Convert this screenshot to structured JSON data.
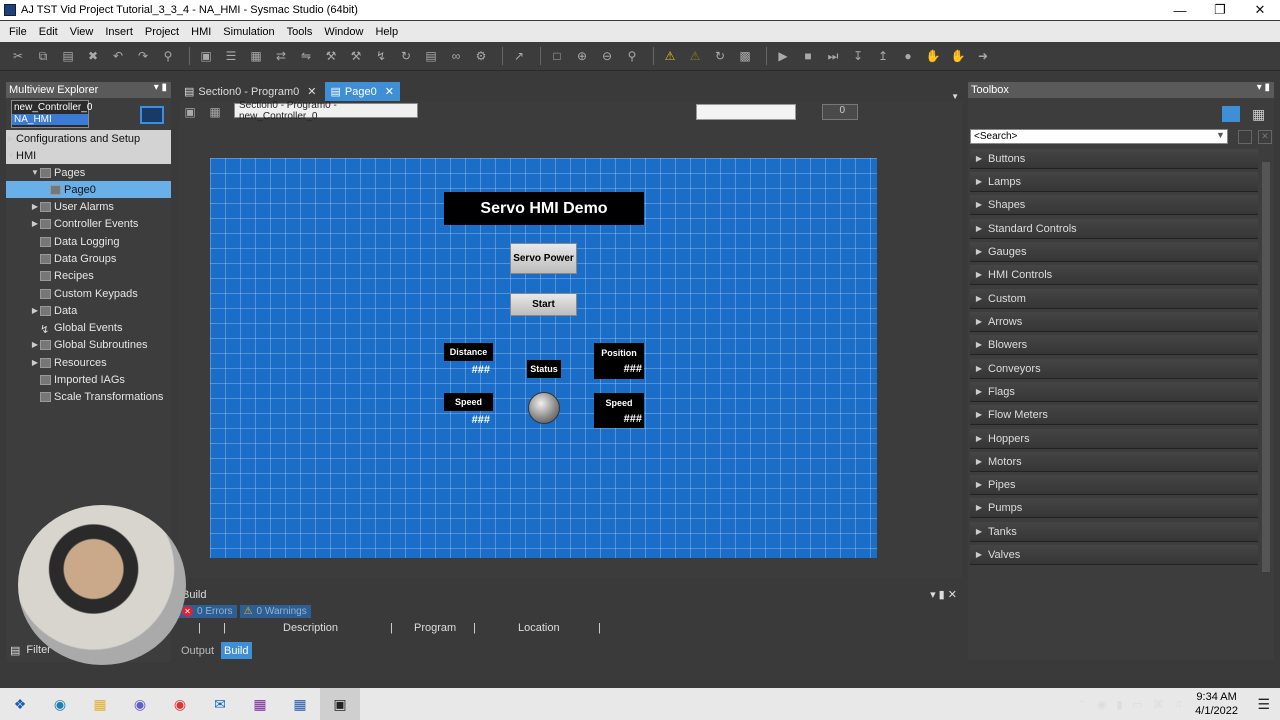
{
  "window": {
    "title": "AJ TST Vid Project Tutorial_3_3_4 - NA_HMI - Sysmac Studio (64bit)"
  },
  "menu": [
    "File",
    "Edit",
    "View",
    "Insert",
    "Project",
    "HMI",
    "Simulation",
    "Tools",
    "Window",
    "Help"
  ],
  "explorer": {
    "title": "Multiview Explorer",
    "controller": "new_Controller_0",
    "device": "NA_HMI",
    "config_label": "Configurations and Setup",
    "hmi_label": "HMI",
    "tree": [
      "Pages",
      "Page0",
      "User Alarms",
      "Controller Events",
      "Data Logging",
      "Data Groups",
      "Recipes",
      "Custom Keypads",
      "Data",
      "Global Events",
      "Global Subroutines",
      "Resources",
      "Imported IAGs",
      "Scale Transformations"
    ],
    "filter_label": "Filter"
  },
  "editor": {
    "tabs": [
      "Section0 - Program0",
      "Page0"
    ],
    "tooltip": "Section0 - Program0 - new_Controller_0",
    "number_value": "0"
  },
  "hmi": {
    "title": "Servo HMI Demo",
    "servo_power": "Servo Power",
    "start": "Start",
    "distance_label": "Distance",
    "distance_value": "###",
    "position_label": "Position",
    "position_value": "###",
    "status_label": "Status",
    "speed_label_1": "Speed",
    "speed_value_1": "###",
    "speed_label_2": "Speed",
    "speed_value_2": "###"
  },
  "build": {
    "title": "Build",
    "errors": "0  Errors",
    "warnings": "0  Warnings",
    "col_description": "Description",
    "col_program": "Program",
    "col_location": "Location",
    "tab_output": "Output",
    "tab_build": "Build"
  },
  "toolbox": {
    "title": "Toolbox",
    "search_placeholder": "<Search>",
    "categories": [
      "Buttons",
      "Lamps",
      "Shapes",
      "Standard Controls",
      "Gauges",
      "HMI Controls",
      "Custom",
      "Arrows",
      "Blowers",
      "Conveyors",
      "Flags",
      "Flow Meters",
      "Hoppers",
      "Motors",
      "Pipes",
      "Pumps",
      "Tanks",
      "Valves"
    ]
  },
  "taskbar": {
    "time": "9:34 AM",
    "date": "4/1/2022"
  }
}
